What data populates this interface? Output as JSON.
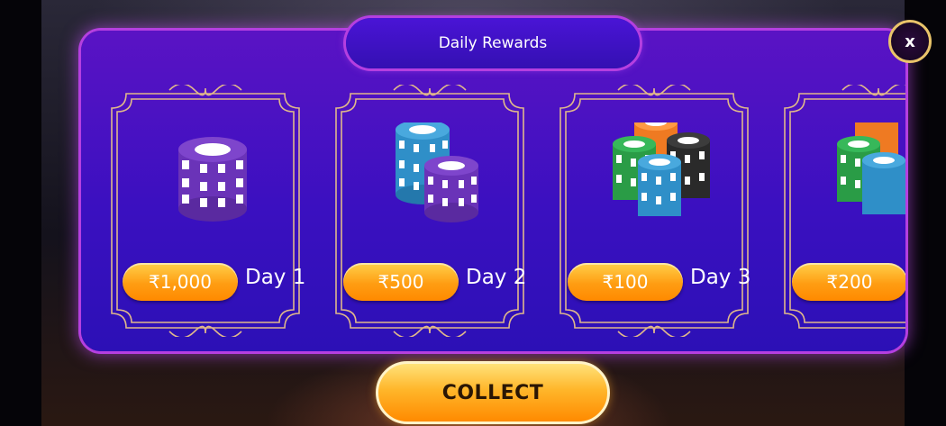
{
  "title": "Daily Rewards",
  "close_label": "x",
  "rewards": [
    {
      "amount": "₹1,000",
      "day": "Day 1",
      "chip_style": "purple-stack"
    },
    {
      "amount": "₹500",
      "day": "Day 2",
      "chip_style": "blue-purple-stacks"
    },
    {
      "amount": "₹100",
      "day": "Day 3",
      "chip_style": "green-blue-black-orange-stacks"
    },
    {
      "amount": "₹200",
      "day": "",
      "chip_style": "orange-green-blue-stacks"
    }
  ],
  "collect_label": "COLLECT",
  "colors": {
    "panel": "#3b10c0",
    "panel_glow": "#b53fe0",
    "button_orange": "#ff9d12",
    "frame_gold": "#e0b88a"
  }
}
